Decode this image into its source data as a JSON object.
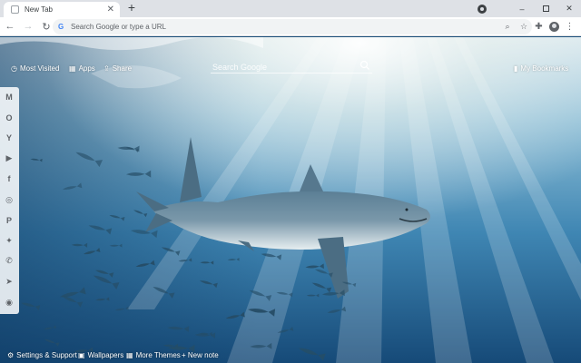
{
  "tab": {
    "title": "New Tab",
    "close_glyph": "✕",
    "new_tab_glyph": "+"
  },
  "window_controls": {
    "minimize": "–",
    "close": "✕"
  },
  "toolbar": {
    "back": "←",
    "forward": "→",
    "reload": "↻",
    "omnibox_placeholder": "Search Google or type a URL",
    "google_glyph": "G",
    "zoom_glyph": "⌕",
    "star_glyph": "☆",
    "extensions_glyph": "✚",
    "menu_glyph": "⋮"
  },
  "newtab": {
    "most_visited": "Most Visited",
    "apps": "Apps",
    "share": "Share",
    "search_placeholder": "Search Google",
    "my_bookmarks": "My Bookmarks",
    "bottom": {
      "settings": "Settings & Support",
      "wallpapers": "Wallpapers",
      "more_themes": "More Themes",
      "new_note": "+ New note"
    }
  },
  "sidebar_items": [
    {
      "name": "gmail-icon",
      "glyph": "M"
    },
    {
      "name": "outlook-icon",
      "glyph": "O"
    },
    {
      "name": "yahoo-icon",
      "glyph": "Y"
    },
    {
      "name": "youtube-icon",
      "glyph": "▶"
    },
    {
      "name": "facebook-icon",
      "glyph": "f"
    },
    {
      "name": "instagram-icon",
      "glyph": "◎"
    },
    {
      "name": "pinterest-icon",
      "glyph": "P"
    },
    {
      "name": "twitter-icon",
      "glyph": "✦"
    },
    {
      "name": "whatsapp-icon",
      "glyph": "✆"
    },
    {
      "name": "telegram-icon",
      "glyph": "➤"
    },
    {
      "name": "reddit-icon",
      "glyph": "◉"
    }
  ],
  "colors": {
    "water_top": "#cfe3ea",
    "water_mid": "#3f86b3",
    "water_deep": "#164a78"
  }
}
